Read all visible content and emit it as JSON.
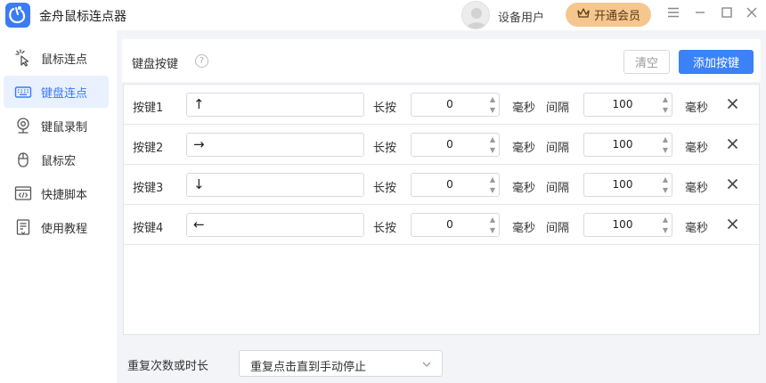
{
  "app": {
    "title": "金舟鼠标连点器"
  },
  "header": {
    "user_name": "设备用户",
    "vip_label": "开通会员"
  },
  "colors": {
    "accent": "#3a82f6",
    "vip": "#f5c78f",
    "active_bg": "#e9f0fe"
  },
  "sidebar": {
    "items": [
      {
        "label": "鼠标连点",
        "icon": "cursor-click-icon",
        "active": false
      },
      {
        "label": "键盘连点",
        "icon": "keyboard-icon",
        "active": true
      },
      {
        "label": "键鼠录制",
        "icon": "webcam-icon",
        "active": false
      },
      {
        "label": "鼠标宏",
        "icon": "mouse-icon",
        "active": false
      },
      {
        "label": "快捷脚本",
        "icon": "code-window-icon",
        "active": false
      },
      {
        "label": "使用教程",
        "icon": "tutorial-doc-icon",
        "active": false
      }
    ]
  },
  "main": {
    "section_title": "键盘按键",
    "clear_label": "清空",
    "add_label": "添加按键",
    "hold_label": "长按",
    "interval_label": "间隔",
    "unit_label": "毫秒",
    "keys": [
      {
        "label": "按键1",
        "key": "↑",
        "hold": "0",
        "interval": "100"
      },
      {
        "label": "按键2",
        "key": "→",
        "hold": "0",
        "interval": "100"
      },
      {
        "label": "按键3",
        "key": "↓",
        "hold": "0",
        "interval": "100"
      },
      {
        "label": "按键4",
        "key": "←",
        "hold": "0",
        "interval": "100"
      }
    ],
    "repeat_label": "重复次数或时长",
    "repeat_value": "重复点击直到手动停止"
  }
}
